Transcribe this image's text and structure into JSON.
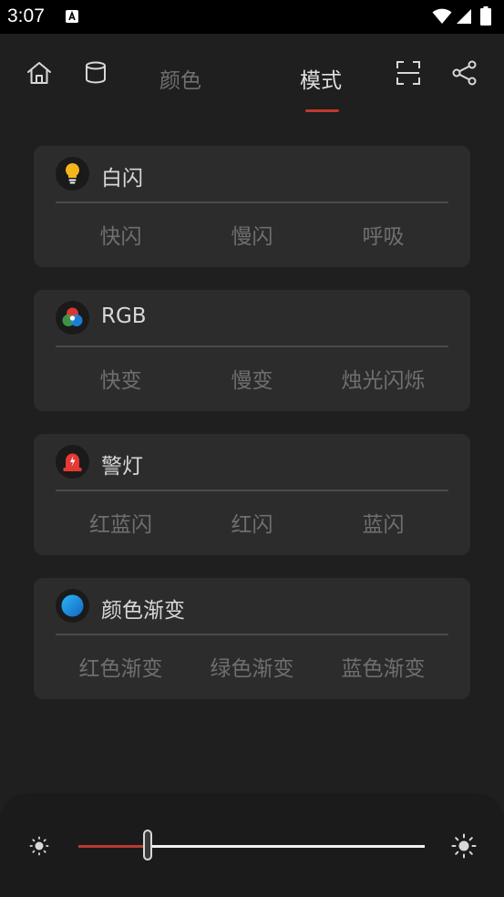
{
  "status_bar": {
    "time": "3:07",
    "icons": [
      "a-notification-icon",
      "wifi-icon",
      "signal-icon",
      "battery-icon"
    ]
  },
  "nav": {
    "tabs": [
      {
        "label": "颜色",
        "active": false
      },
      {
        "label": "模式",
        "active": true
      }
    ],
    "icons": [
      "home-icon",
      "cylinder-icon",
      "scan-icon",
      "share-icon"
    ],
    "accent_color": "#c0392b"
  },
  "cards": [
    {
      "title": "白闪",
      "icon": "lightbulb-icon",
      "options": [
        "快闪",
        "慢闪",
        "呼吸"
      ]
    },
    {
      "title": "RGB",
      "icon": "rgb-circles-icon",
      "options": [
        "快变",
        "慢变",
        "烛光闪烁"
      ]
    },
    {
      "title": "警灯",
      "icon": "alarm-light-icon",
      "options": [
        "红蓝闪",
        "红闪",
        "蓝闪"
      ]
    },
    {
      "title": "颜色渐变",
      "icon": "gradient-circle-icon",
      "options": [
        "红色渐变",
        "绿色渐变",
        "蓝色渐变"
      ]
    }
  ],
  "brightness": {
    "value": 0.2,
    "icons": [
      "brightness-low-icon",
      "brightness-high-icon"
    ],
    "fill_color": "#b63a34"
  }
}
